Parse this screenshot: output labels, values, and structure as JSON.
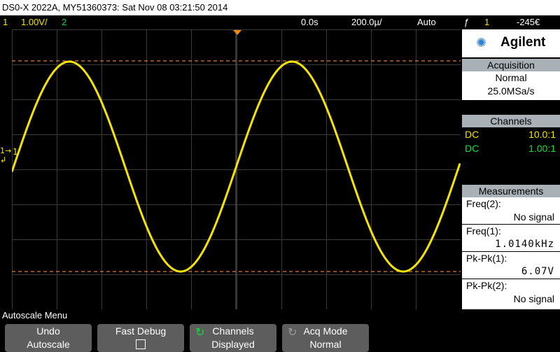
{
  "titlebar": "DS0-X 2022A, MY51360373: Sat Nov 08 03:21:50 2014",
  "status": {
    "ch1_label": "1",
    "ch1_scale": "1.00V/",
    "ch2_label": "2",
    "time_offset": "0.0s",
    "timebase": "200.0µ/",
    "trigger_mode": "Auto",
    "trigger_symbol": "ƒ",
    "trigger_source": "1",
    "trigger_level": "-245€"
  },
  "colors": {
    "ch1": "#f5e400",
    "ch2": "#19d93f",
    "marker": "#f08a16",
    "panel_header": "#a9b0b6"
  },
  "plot_markers": {
    "ch1_ground": "1→",
    "ch1_id": "1",
    "trigger_level_icon": "↲"
  },
  "logo": {
    "name": "Agilent",
    "icon": "agilent-spark-icon"
  },
  "acquisition": {
    "title": "Acquisition",
    "mode": "Normal",
    "rate": "25.0MSa/s"
  },
  "channels": {
    "title": "Channels",
    "rows": [
      {
        "coupling": "DC",
        "probe": "10.0:1",
        "color": "#f5e400"
      },
      {
        "coupling": "DC",
        "probe": "1.00:1",
        "color": "#19d93f"
      }
    ]
  },
  "measurements": {
    "title": "Measurements",
    "items": [
      {
        "name": "Freq(2):",
        "value": "No signal"
      },
      {
        "name": "Freq(1):",
        "value": "1.0140kHz"
      },
      {
        "name": "Pk-Pk(1):",
        "value": "6.07V"
      },
      {
        "name": "Pk-Pk(2):",
        "value": "No signal"
      }
    ]
  },
  "menu": {
    "title": "Autoscale Menu",
    "softkeys": [
      {
        "line1": "Undo",
        "line2": "Autoscale"
      },
      {
        "line1": "Fast Debug",
        "line2": ""
      },
      {
        "line1": "Channels",
        "line2": "Displayed"
      },
      {
        "line1": "Acq Mode",
        "line2": "Normal"
      }
    ]
  }
}
